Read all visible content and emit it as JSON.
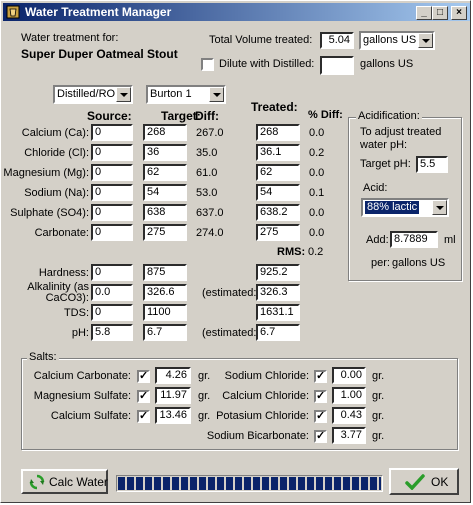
{
  "window": {
    "title": "Water Treatment Manager",
    "min": "_",
    "max": "□",
    "close": "×"
  },
  "header": {
    "treatment_for_label": "Water treatment for:",
    "recipe_name": "Super Duper Oatmeal Stout",
    "total_volume_label": "Total Volume treated:",
    "total_volume_value": "5.04",
    "volume_unit": "gallons US",
    "dilute_label": "Dilute with Distilled:",
    "dilute_value": "",
    "dilute_unit": "gallons US"
  },
  "profiles": {
    "source": "Distilled/RO",
    "target": "Burton 1"
  },
  "columns": {
    "source": "Source:",
    "target": "Target:",
    "diff": "Diff:",
    "treated": "Treated:",
    "pct_diff": "% Diff:"
  },
  "ions": [
    {
      "label": "Calcium (Ca):",
      "source": "0",
      "target": "268",
      "diff": "267.0",
      "treated": "268",
      "pct": "0.0"
    },
    {
      "label": "Chloride (Cl):",
      "source": "0",
      "target": "36",
      "diff": "35.0",
      "treated": "36.1",
      "pct": "0.2"
    },
    {
      "label": "Magnesium (Mg):",
      "source": "0",
      "target": "62",
      "diff": "61.0",
      "treated": "62",
      "pct": "0.0"
    },
    {
      "label": "Sodium (Na):",
      "source": "0",
      "target": "54",
      "diff": "53.0",
      "treated": "54",
      "pct": "0.1"
    },
    {
      "label": "Sulphate (SO4):",
      "source": "0",
      "target": "638",
      "diff": "637.0",
      "treated": "638.2",
      "pct": "0.0"
    },
    {
      "label": "Carbonate:",
      "source": "0",
      "target": "275",
      "diff": "274.0",
      "treated": "275",
      "pct": "0.0"
    }
  ],
  "rms": {
    "label": "RMS:",
    "value": "0.2"
  },
  "extra": [
    {
      "label": "Hardness:",
      "source": "0",
      "target": "875",
      "note": "",
      "treated": "925.2"
    },
    {
      "label_l1": "Alkalinity (as",
      "label_l2": "CaCO3):",
      "source": "0.0",
      "target": "326.6",
      "note": "(estimated:)",
      "treated": "326.3"
    },
    {
      "label": "TDS:",
      "source": "0",
      "target": "1100",
      "note": "",
      "treated": "1631.1"
    },
    {
      "label": "pH:",
      "source": "5.8",
      "target": "6.7",
      "note": "(estimated:)",
      "treated": "6.7"
    }
  ],
  "acid": {
    "group_label": "Acidification:",
    "desc_l1": "To adjust treated",
    "desc_l2": "water pH:",
    "target_ph_label": "Target pH:",
    "target_ph_value": "5.5",
    "acid_label": "Acid:",
    "acid_value": "88% lactic",
    "add_label": "Add:",
    "add_value": "8.7889",
    "add_unit": "ml",
    "per_label": "per:",
    "per_unit": "gallons US"
  },
  "salts": {
    "group_label": "Salts:",
    "unit": "gr.",
    "left": [
      {
        "label": "Calcium Carbonate:",
        "checked": "✓",
        "value": "4.26"
      },
      {
        "label": "Magnesium Sulfate:",
        "checked": "✓",
        "value": "11.97"
      },
      {
        "label": "Calcium Sulfate:",
        "checked": "✓",
        "value": "13.46"
      }
    ],
    "right": [
      {
        "label": "Sodium Chloride:",
        "checked": "✓",
        "value": "0.00"
      },
      {
        "label": "Calcium Chloride:",
        "checked": "✓",
        "value": "1.00"
      },
      {
        "label": "Potasium Chloride:",
        "checked": "✓",
        "value": "0.43"
      },
      {
        "label": "Sodium Bicarbonate:",
        "checked": "✓",
        "value": "3.77"
      }
    ]
  },
  "footer": {
    "calc_label": "Calc Water",
    "ok_label": "OK",
    "progress": 1.0
  },
  "colors": {
    "title_start": "#0a246a",
    "title_end": "#a6caf0",
    "progress": "#0a246a",
    "select_bg": "#0a246a",
    "ok_check": "#2a9d2a",
    "calc_icon": "#2a9d2a"
  },
  "icons": {
    "title": "water-drop-icon",
    "calc": "refresh-arrows-icon",
    "ok": "checkmark-icon"
  }
}
